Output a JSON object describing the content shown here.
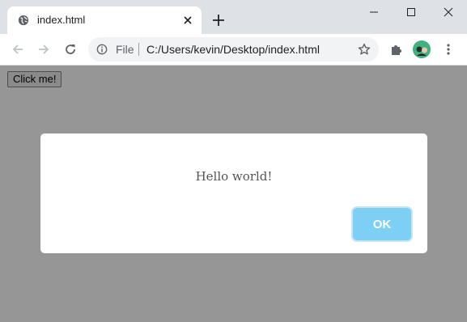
{
  "browser": {
    "tab": {
      "title": "index.html",
      "favicon_icon": "globe-icon",
      "close_icon": "close-icon"
    },
    "new_tab_icon": "plus-icon",
    "window_controls": [
      "minimize-icon",
      "maximize-icon",
      "close-icon"
    ],
    "toolbar": {
      "back_icon": "arrow-left-icon",
      "forward_icon": "arrow-right-icon",
      "reload_icon": "reload-icon",
      "site_info_icon": "info-icon",
      "scheme_label": "File",
      "url": "C:/Users/kevin/Desktop/index.html",
      "bookmark_icon": "star-icon",
      "extensions_icon": "puzzle-icon",
      "menu_icon": "kebab-menu-icon"
    }
  },
  "page": {
    "button_label": "Click me!",
    "background_color": "#969696"
  },
  "dialog": {
    "message": "Hello world!",
    "ok_label": "OK",
    "ok_color": "#7ecff4"
  }
}
